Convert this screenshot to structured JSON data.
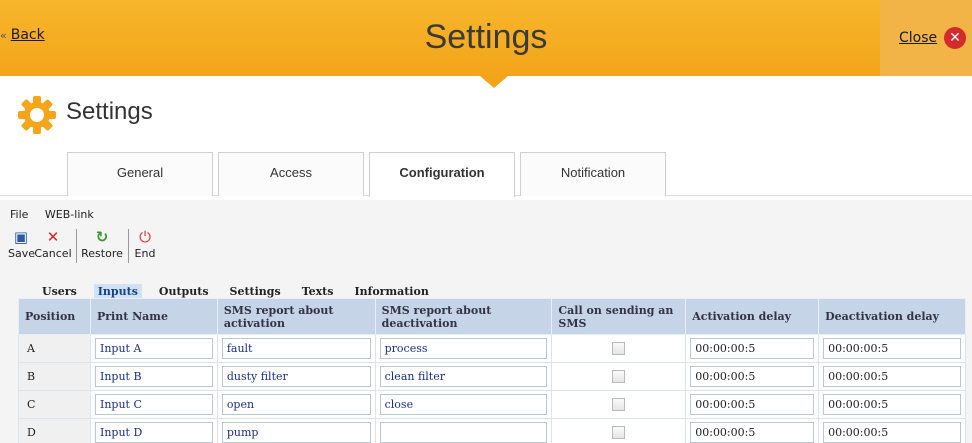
{
  "topbar": {
    "back_label": "Back",
    "title": "Settings",
    "close_label": "Close"
  },
  "header": {
    "title": "Settings"
  },
  "main_tabs": [
    {
      "label": "General",
      "active": false
    },
    {
      "label": "Access",
      "active": false
    },
    {
      "label": "Configuration",
      "active": true
    },
    {
      "label": "Notification",
      "active": false
    }
  ],
  "menu": {
    "file": "File",
    "weblink": "WEB-link"
  },
  "toolbar": {
    "save": "Save",
    "cancel": "Cancel",
    "restore": "Restore",
    "end": "End"
  },
  "sub_tabs": [
    {
      "label": "Users",
      "active": false
    },
    {
      "label": "Inputs",
      "active": true
    },
    {
      "label": "Outputs",
      "active": false
    },
    {
      "label": "Settings",
      "active": false
    },
    {
      "label": "Texts",
      "active": false
    },
    {
      "label": "Information",
      "active": false
    }
  ],
  "table": {
    "headers": [
      "Position",
      "Print Name",
      "SMS report about activation",
      "SMS report about deactivation",
      "Call on sending an SMS",
      "Activation delay",
      "Deactivation delay"
    ],
    "rows": [
      {
        "position": "A",
        "print_name": "Input A",
        "sms_act": "fault",
        "sms_deact": "process",
        "call": false,
        "act_delay": "00:00:00:5",
        "deact_delay": "00:00:00:5"
      },
      {
        "position": "B",
        "print_name": "Input B",
        "sms_act": "dusty filter",
        "sms_deact": "clean filter",
        "call": false,
        "act_delay": "00:00:00:5",
        "deact_delay": "00:00:00:5"
      },
      {
        "position": "C",
        "print_name": "Input C",
        "sms_act": "open",
        "sms_deact": "close",
        "call": false,
        "act_delay": "00:00:00:5",
        "deact_delay": "00:00:00:5"
      },
      {
        "position": "D",
        "print_name": "Input D",
        "sms_act": "pump",
        "sms_deact": "",
        "call": false,
        "act_delay": "00:00:00:5",
        "deact_delay": "00:00:00:5"
      }
    ]
  },
  "colors": {
    "topbar": "#f3a51a",
    "close_icon": "#d32a2a",
    "table_header": "#c5d4e6",
    "active_subtab": "#cfe3f5"
  }
}
